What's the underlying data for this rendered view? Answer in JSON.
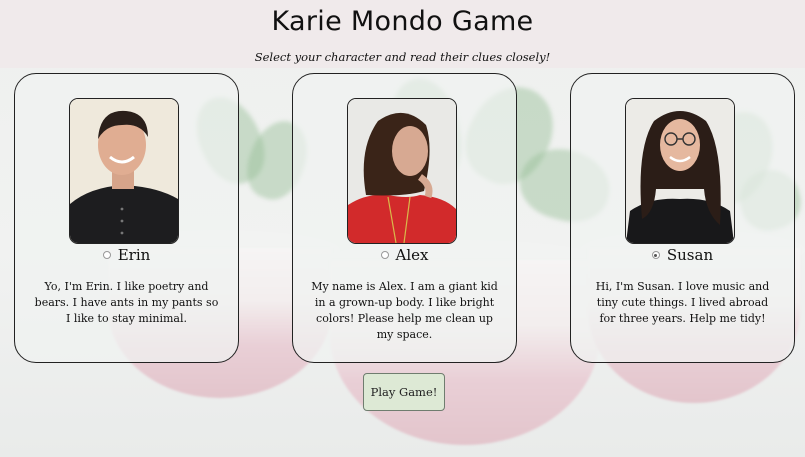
{
  "header": {
    "title": "Karie Mondo Game",
    "subtitle": "Select your character and read their clues closely!"
  },
  "characters": [
    {
      "name": "Erin",
      "bio": "Yo, I'm Erin. I like poetry and bears. I have ants in my pants so I like to stay minimal.",
      "photo": "erin-portrait",
      "selected": false
    },
    {
      "name": "Alex",
      "bio": "My name is Alex. I am a giant kid in a grown-up body. I like bright colors! Please help me clean up my space.",
      "photo": "alex-portrait",
      "selected": false
    },
    {
      "name": "Susan",
      "bio": "Hi, I'm Susan. I love music and tiny cute things. I lived abroad for three years. Help me tidy!",
      "photo": "susan-portrait",
      "selected": true
    }
  ],
  "play_button": {
    "label": "Play Game!"
  },
  "colors": {
    "header_bg": "#f0e8eb",
    "button_bg": "#dde9d5",
    "card_border": "#222222"
  }
}
